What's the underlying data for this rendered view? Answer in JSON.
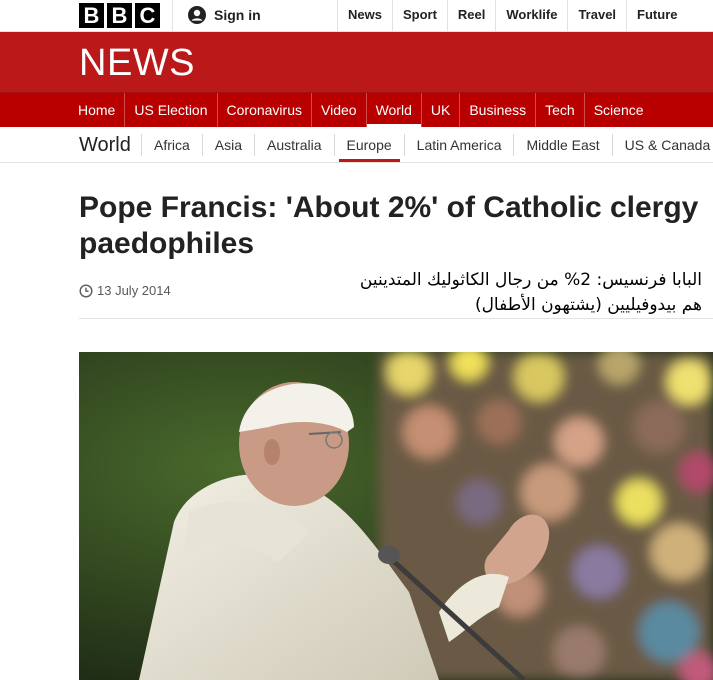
{
  "brand": {
    "letters": [
      "B",
      "B",
      "C"
    ]
  },
  "account": {
    "sign_in_label": "Sign in",
    "icon": "user-icon"
  },
  "top_nav": [
    "News",
    "Sport",
    "Reel",
    "Worklife",
    "Travel",
    "Future"
  ],
  "news_band": {
    "title": "NEWS"
  },
  "main_nav": {
    "items": [
      "Home",
      "US Election",
      "Coronavirus",
      "Video",
      "World",
      "UK",
      "Business",
      "Tech",
      "Science"
    ],
    "active": "World"
  },
  "section_nav": {
    "title": "World",
    "items": [
      "Africa",
      "Asia",
      "Australia",
      "Europe",
      "Latin America",
      "Middle East",
      "US & Canada"
    ],
    "active": "Europe"
  },
  "article": {
    "headline": "Pope Francis: 'About 2%' of Catholic clergy paedophiles",
    "date": "13 July 2014",
    "date_icon": "clock-icon",
    "arabic_caption_line1": "البابا فرنسيس: 2%  من رجال الكاثوليك المتدينين",
    "arabic_caption_line2": "هم بيدوفيليين (يشتهون الأطفال)"
  },
  "colors": {
    "brand_red": "#bb1919",
    "nav_red": "#b80000",
    "text": "#222222"
  }
}
